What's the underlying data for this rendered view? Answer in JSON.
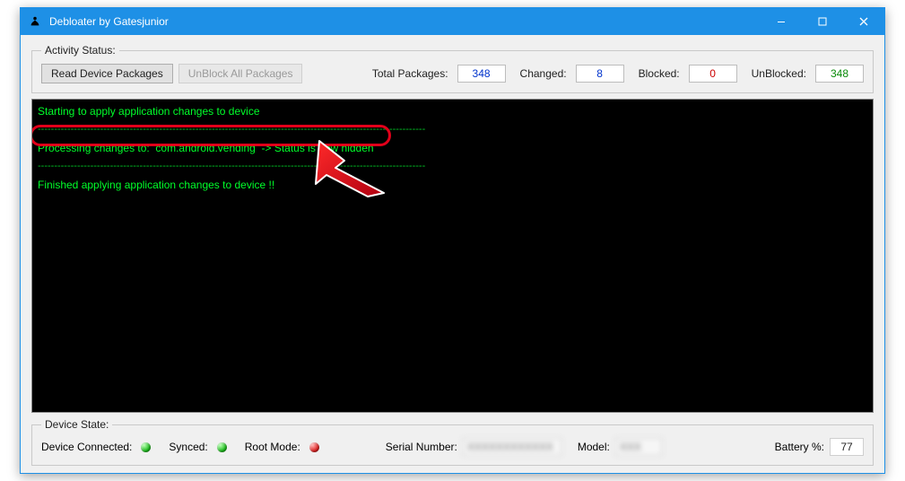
{
  "window": {
    "title": "Debloater by Gatesjunior"
  },
  "activity": {
    "legend": "Activity Status:",
    "read_btn": "Read Device Packages",
    "unblock_btn": "UnBlock All Packages",
    "labels": {
      "total": "Total Packages:",
      "changed": "Changed:",
      "blocked": "Blocked:",
      "unblocked": "UnBlocked:"
    },
    "values": {
      "total": "348",
      "changed": "8",
      "blocked": "0",
      "unblocked": "348"
    }
  },
  "console": {
    "line1": "Starting to apply application changes to device",
    "line2": "Processing changes to:  com.android.vending  -> Status is now hidden",
    "line3": "Finished applying application changes to device !!",
    "dashes": "----------------------------------------------------------------------------------------------------------------------"
  },
  "device": {
    "legend": "Device State:",
    "labels": {
      "connected": "Device Connected:",
      "synced": "Synced:",
      "rootmode": "Root Mode:",
      "serial": "Serial Number:",
      "model": "Model:",
      "battery": "Battery %:"
    },
    "values": {
      "serial": "XXXXXXXXXXXX",
      "model": "XXX",
      "battery": "77"
    }
  }
}
